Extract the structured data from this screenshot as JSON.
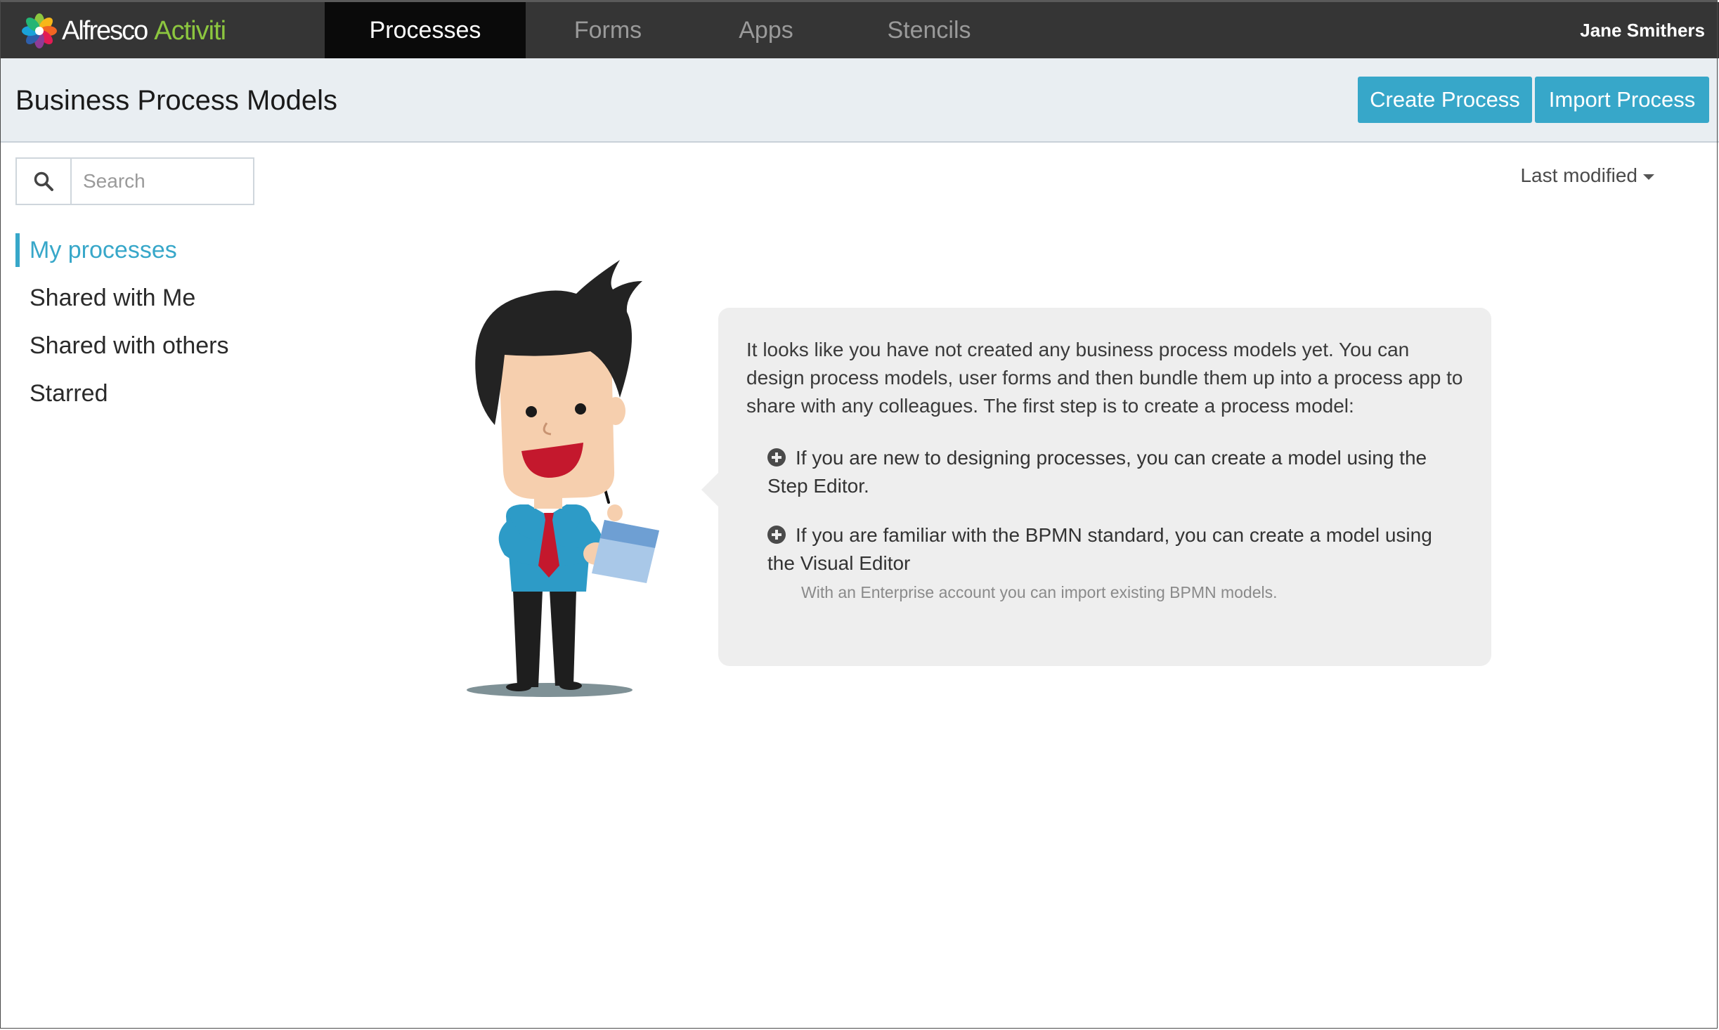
{
  "brand": {
    "name_part1": "Alfresco",
    "name_part2": "Activiti"
  },
  "nav": {
    "tabs": [
      {
        "label": "Processes",
        "active": true
      },
      {
        "label": "Forms",
        "active": false
      },
      {
        "label": "Apps",
        "active": false
      },
      {
        "label": "Stencils",
        "active": false
      }
    ],
    "user": "Jane Smithers"
  },
  "header": {
    "title": "Business Process Models",
    "create_label": "Create Process",
    "import_label": "Import Process"
  },
  "search": {
    "placeholder": "Search",
    "value": ""
  },
  "sort": {
    "label": "Last modified"
  },
  "sidebar": {
    "items": [
      {
        "label": "My processes",
        "active": true
      },
      {
        "label": "Shared with Me",
        "active": false
      },
      {
        "label": "Shared with others",
        "active": false
      },
      {
        "label": "Starred",
        "active": false
      }
    ]
  },
  "empty_state": {
    "intro": "It looks like you have not created any business process models yet. You can design process models, user forms and then bundle them up into a process app to share with any colleagues. The first step is to create a process model:",
    "tips": [
      {
        "text": "If you are new to designing processes, you can create a model using the Step Editor."
      },
      {
        "text": "If you are familiar with the BPMN standard, you can create a model using the Visual Editor",
        "note": "With an Enterprise account you can import existing BPMN models."
      }
    ]
  },
  "colors": {
    "accent": "#37a7c9",
    "navbar": "#353535",
    "brand_green": "#8cc63f"
  }
}
